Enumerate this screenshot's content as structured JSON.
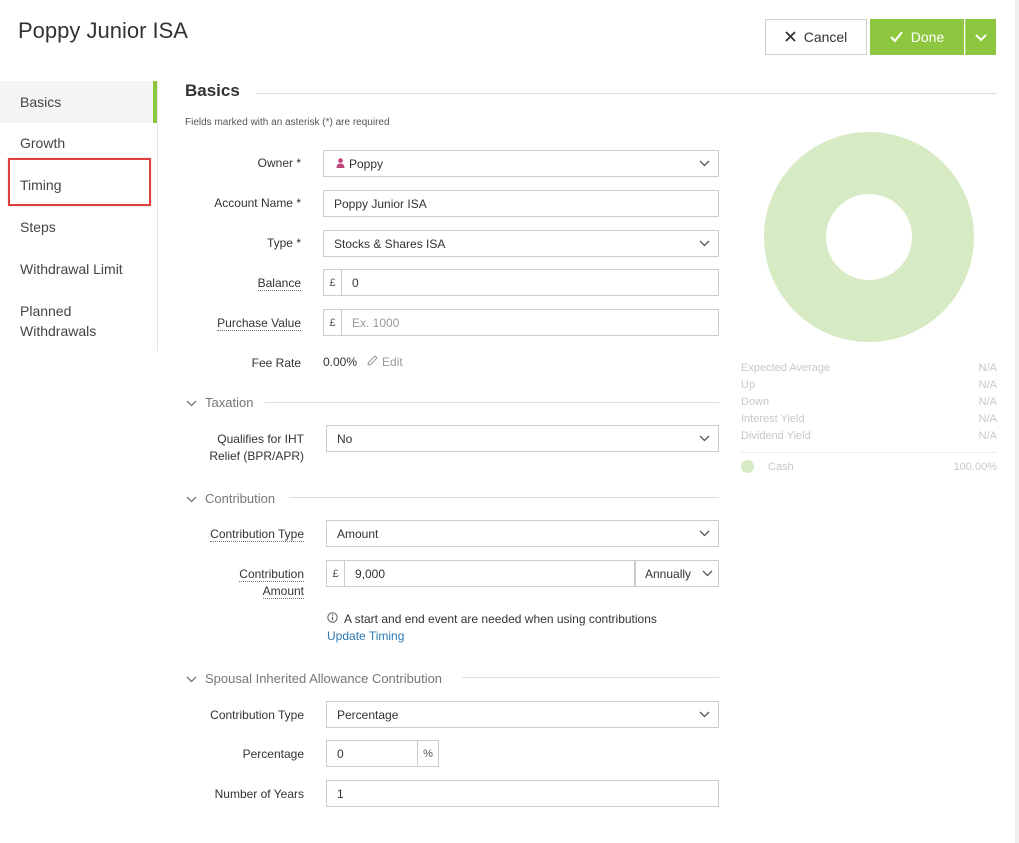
{
  "header": {
    "title": "Poppy Junior ISA",
    "cancel_label": "Cancel",
    "done_label": "Done"
  },
  "sidebar": {
    "items": [
      {
        "label": "Basics",
        "active": true
      },
      {
        "label": "Growth"
      },
      {
        "label": "Timing"
      },
      {
        "label": "Steps"
      },
      {
        "label": "Withdrawal Limit"
      },
      {
        "label": "Planned",
        "label2": "Withdrawals"
      }
    ]
  },
  "main": {
    "section_title": "Basics",
    "required_note": "Fields marked with an asterisk (*) are required",
    "owner": {
      "label": "Owner *",
      "value": "Poppy"
    },
    "account_name": {
      "label": "Account Name *",
      "value": "Poppy Junior ISA"
    },
    "type": {
      "label": "Type *",
      "value": "Stocks & Shares ISA"
    },
    "balance": {
      "label": "Balance",
      "currency": "£",
      "value": "0"
    },
    "purchase_value": {
      "label": "Purchase Value",
      "currency": "£",
      "placeholder": "Ex. 1000"
    },
    "fee_rate": {
      "label": "Fee Rate",
      "value": "0.00%",
      "edit_label": "Edit"
    },
    "taxation": {
      "heading": "Taxation",
      "iht_label_line1": "Qualifies for IHT",
      "iht_label_line2": "Relief (BPR/APR)",
      "iht_value": "No"
    },
    "contribution": {
      "heading": "Contribution",
      "type_label": "Contribution Type",
      "type_value": "Amount",
      "amount_label_line1": "Contribution",
      "amount_label_line2": "Amount",
      "currency": "£",
      "amount_value": "9,000",
      "frequency": "Annually",
      "info_text": "A start and end event are needed when using contributions",
      "update_link": "Update Timing"
    },
    "spousal": {
      "heading": "Spousal Inherited Allowance Contribution",
      "type_label": "Contribution Type",
      "type_value": "Percentage",
      "percentage_label": "Percentage",
      "percentage_value": "0",
      "percent_suffix": "%",
      "years_label": "Number of Years",
      "years_value": "1"
    }
  },
  "stats": {
    "rows": [
      {
        "label": "Expected Average",
        "value": "N/A"
      },
      {
        "label": "Up",
        "value": "N/A"
      },
      {
        "label": "Down",
        "value": "N/A"
      },
      {
        "label": "Interest Yield",
        "value": "N/A"
      },
      {
        "label": "Dividend Yield",
        "value": "N/A"
      }
    ],
    "legend": {
      "label": "Cash",
      "value": "100.00%"
    }
  },
  "colors": {
    "accent": "#8dc63f",
    "donut": "#d6ebc4",
    "highlight": "#e53e3e",
    "link": "#2a7ab8",
    "owner_icon": "#c0437a"
  },
  "icons": [
    "close-icon",
    "check-icon",
    "chevron-down-icon",
    "person-icon",
    "pencil-icon",
    "info-icon"
  ]
}
